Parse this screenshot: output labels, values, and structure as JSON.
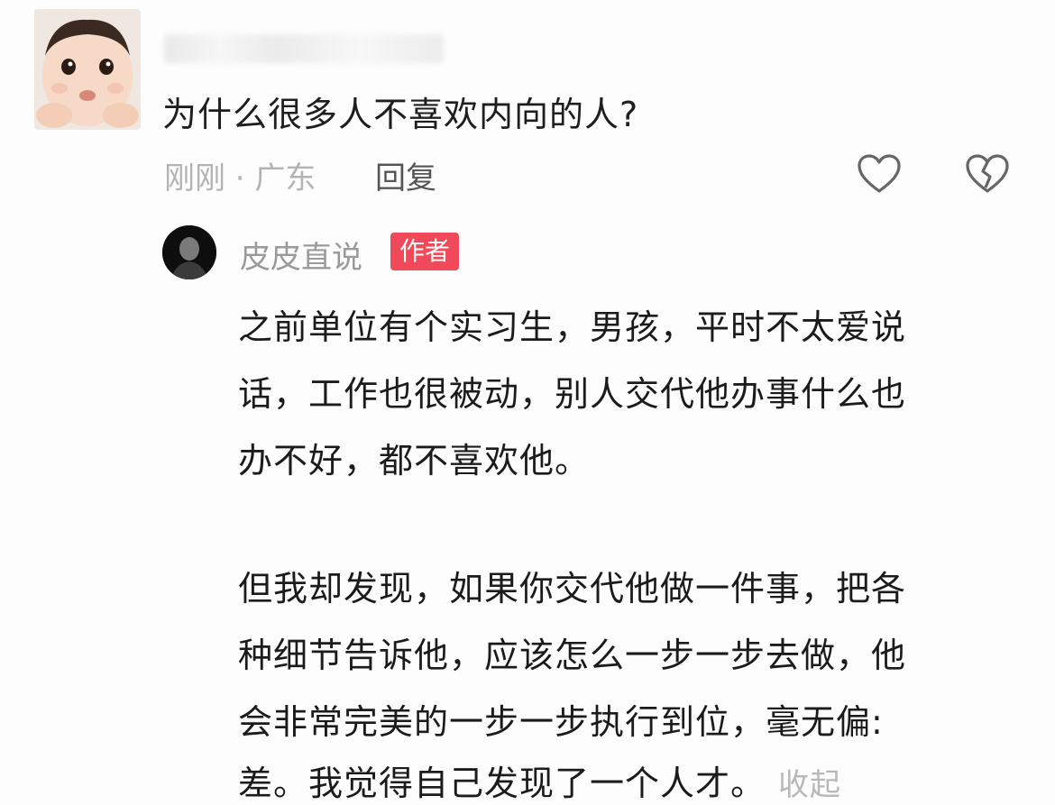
{
  "comment": {
    "question": "为什么很多人不喜欢内向的人?",
    "time": "刚刚",
    "location": "广东",
    "meta_separator": " · ",
    "reply_label": "回复",
    "icons": {
      "like": "heart-outline-icon",
      "dislike": "broken-heart-icon"
    }
  },
  "reply": {
    "name": "皮皮直说",
    "badge": "作者",
    "badge_color": "#f04a5a",
    "lines": [
      "之前单位有个实习生，男孩，平时不太爱说",
      "话，工作也很被动，别人交代他办事什么也",
      "办不好，都不喜欢他。",
      "",
      "但我却发现，如果你交代他做一件事，把各",
      "种细节告诉他，应该怎么一步一步去做，他",
      "会非常完美的一步一步执行到位，毫无偏:",
      "差。我觉得自己发现了一个人才。"
    ],
    "collapse_label": "收起"
  }
}
